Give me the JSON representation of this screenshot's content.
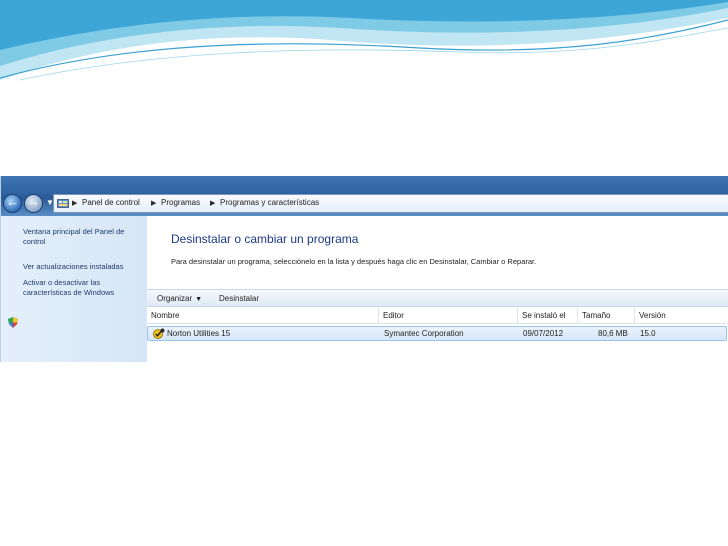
{
  "breadcrumb": {
    "items": [
      "Panel de control",
      "Programas",
      "Programas y características"
    ]
  },
  "tasks": {
    "items": [
      "Ventana principal del Panel de control",
      "Ver actualizaciones instaladas",
      "Activar o desactivar las características de Windows"
    ]
  },
  "content": {
    "title": "Desinstalar o cambiar un programa",
    "subtitle": "Para desinstalar un programa, selecciónelo en la lista y después haga clic en Desinstalar, Cambiar o Reparar."
  },
  "toolbar": {
    "organize_label": "Organizar",
    "uninstall_label": "Desinstalar"
  },
  "table": {
    "columns": [
      "Nombre",
      "Editor",
      "Se instaló el",
      "Tamaño",
      "Versión"
    ],
    "rows": [
      [
        "Norton Utilities 15",
        "Symantec Corporation",
        "09/07/2012",
        "80,6 MB",
        "15.0"
      ]
    ]
  },
  "colors": {
    "address_bar": "#2f62a0",
    "task_pane": "#dbe8f6",
    "title_text": "#1e3a87",
    "selected_row": "#d6e7f8"
  }
}
